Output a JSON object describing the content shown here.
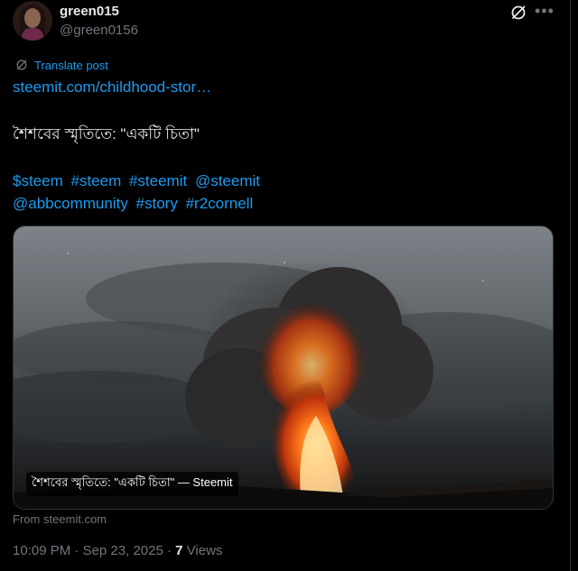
{
  "author": {
    "display_name": "green015",
    "handle": "@green0156"
  },
  "translate": {
    "label": "Translate post"
  },
  "post": {
    "link_text": "steemit.com/childhood-stor…",
    "title": "শৈশবের স্মৃতিতে: \"একটি চিতা\"",
    "hashtags_line1": [
      "$steem",
      "#steem",
      "#steemit",
      "@steemit"
    ],
    "hashtags_line2": [
      "@abbcommunity",
      "#story",
      "#r2cornell"
    ]
  },
  "card": {
    "caption": "শৈশবের স্মৃতিতে: \"একটি চিতা\" — Steemit",
    "source_label": "From steemit.com"
  },
  "meta": {
    "time": "10:09 PM",
    "separator": " · ",
    "date": "Sep 23, 2025",
    "separator2": " · ",
    "views_count": "7",
    "views_label": " Views"
  },
  "colors": {
    "background": "#000000",
    "link": "#1d9bf0",
    "text": "#e7e9ea",
    "muted": "#71767b"
  },
  "icons": [
    "grok-icon",
    "more-icon",
    "translate-icon"
  ]
}
